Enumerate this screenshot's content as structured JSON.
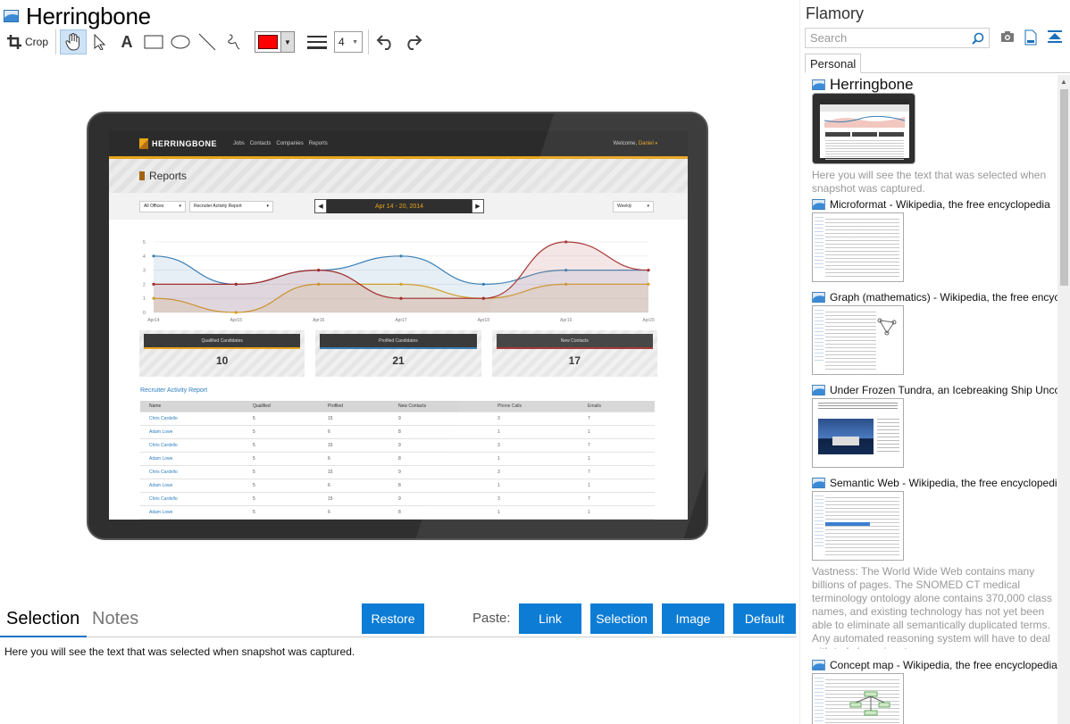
{
  "window": {
    "title": "Herringbone"
  },
  "toolbar": {
    "crop_label": "Crop",
    "line_width": "4",
    "color": "#ff0000"
  },
  "snapshot": {
    "brand": "HERRINGBONE",
    "nav": [
      "Jobs",
      "Contacts",
      "Companies",
      "Reports"
    ],
    "welcome_prefix": "Welcome,",
    "welcome_user": "Daniel",
    "page_title": "Reports",
    "filter_office": "All Offices",
    "filter_report": "Recruiter Activity Report",
    "date_range": "Apr 14 - 20, 2014",
    "filter_period": "Weekly",
    "chart_data": {
      "type": "line",
      "categories": [
        "Apr14",
        "Apr15",
        "Apr16",
        "Apr17",
        "Apr18",
        "Apr19",
        "Apr20"
      ],
      "ylim": [
        0,
        5
      ],
      "yticks": [
        "0",
        "1",
        "2",
        "3",
        "4",
        "5"
      ],
      "series": [
        {
          "name": "Qualified Candidates",
          "color": "#e8a41a",
          "values": [
            1,
            0,
            2,
            2,
            1,
            2,
            2
          ]
        },
        {
          "name": "Profiled Candidates",
          "color": "#3a7fb5",
          "values": [
            4,
            2,
            3,
            4,
            2,
            3,
            3
          ]
        },
        {
          "name": "New Contacts",
          "color": "#a32a2a",
          "values": [
            2,
            2,
            3,
            1,
            1,
            5,
            3
          ]
        }
      ]
    },
    "cards": [
      {
        "label": "Qualified Candidates",
        "value": "10",
        "color": "#e8a41a"
      },
      {
        "label": "Profiled Candidates",
        "value": "21",
        "color": "#3a7fb5"
      },
      {
        "label": "New Contacts",
        "value": "17",
        "color": "#a32a2a"
      }
    ],
    "table_title": "Recruiter Activity Report",
    "table_headers": [
      "Name",
      "Qualified",
      "Profiled",
      "New Contacts",
      "Phone Calls",
      "Emails"
    ],
    "table_rows": [
      [
        "Chris Cardello",
        "5",
        "15",
        "9",
        "3",
        "7"
      ],
      [
        "Adam Lowe",
        "5",
        "6",
        "8",
        "1",
        "1"
      ],
      [
        "Chris Cardello",
        "5",
        "15",
        "9",
        "3",
        "7"
      ],
      [
        "Adam Lowe",
        "5",
        "6",
        "8",
        "1",
        "1"
      ],
      [
        "Chris Cardello",
        "5",
        "15",
        "9",
        "3",
        "7"
      ],
      [
        "Adam Lowe",
        "5",
        "6",
        "8",
        "1",
        "1"
      ],
      [
        "Chris Cardello",
        "5",
        "15",
        "9",
        "3",
        "7"
      ],
      [
        "Adam Lowe",
        "5",
        "6",
        "8",
        "1",
        "1"
      ]
    ]
  },
  "bottom": {
    "tab_selection": "Selection",
    "tab_notes": "Notes",
    "restore_label": "Restore",
    "paste_label": "Paste:",
    "paste_link": "Link",
    "paste_selection": "Selection",
    "paste_image": "Image",
    "paste_default": "Default",
    "selected_text": "Here you will see the text that was selected when snapshot was captured."
  },
  "sidebar": {
    "app_name": "Flamory",
    "search_placeholder": "Search",
    "tab_personal": "Personal",
    "items": [
      {
        "title": "Herringbone",
        "desc": "Here you will see the text that was selected when snapshot was captured."
      },
      {
        "title": "Microformat - Wikipedia, the free encyclopedia"
      },
      {
        "title": "Graph (mathematics) - Wikipedia, the free encyclopedia"
      },
      {
        "title": "Under Frozen Tundra, an Icebreaking Ship Uncovers"
      },
      {
        "title": "Semantic Web - Wikipedia, the free encyclopedia",
        "desc": "Vastness: The World Wide Web contains many billions of pages. The SNOMED CT medical terminology ontology alone contains 370,000 class names, and existing technology has not yet been able to eliminate all semantically duplicated terms. Any automated reasoning system will have to deal with truly huge inputs."
      },
      {
        "title": "Concept map - Wikipedia, the free encyclopedia"
      }
    ]
  }
}
